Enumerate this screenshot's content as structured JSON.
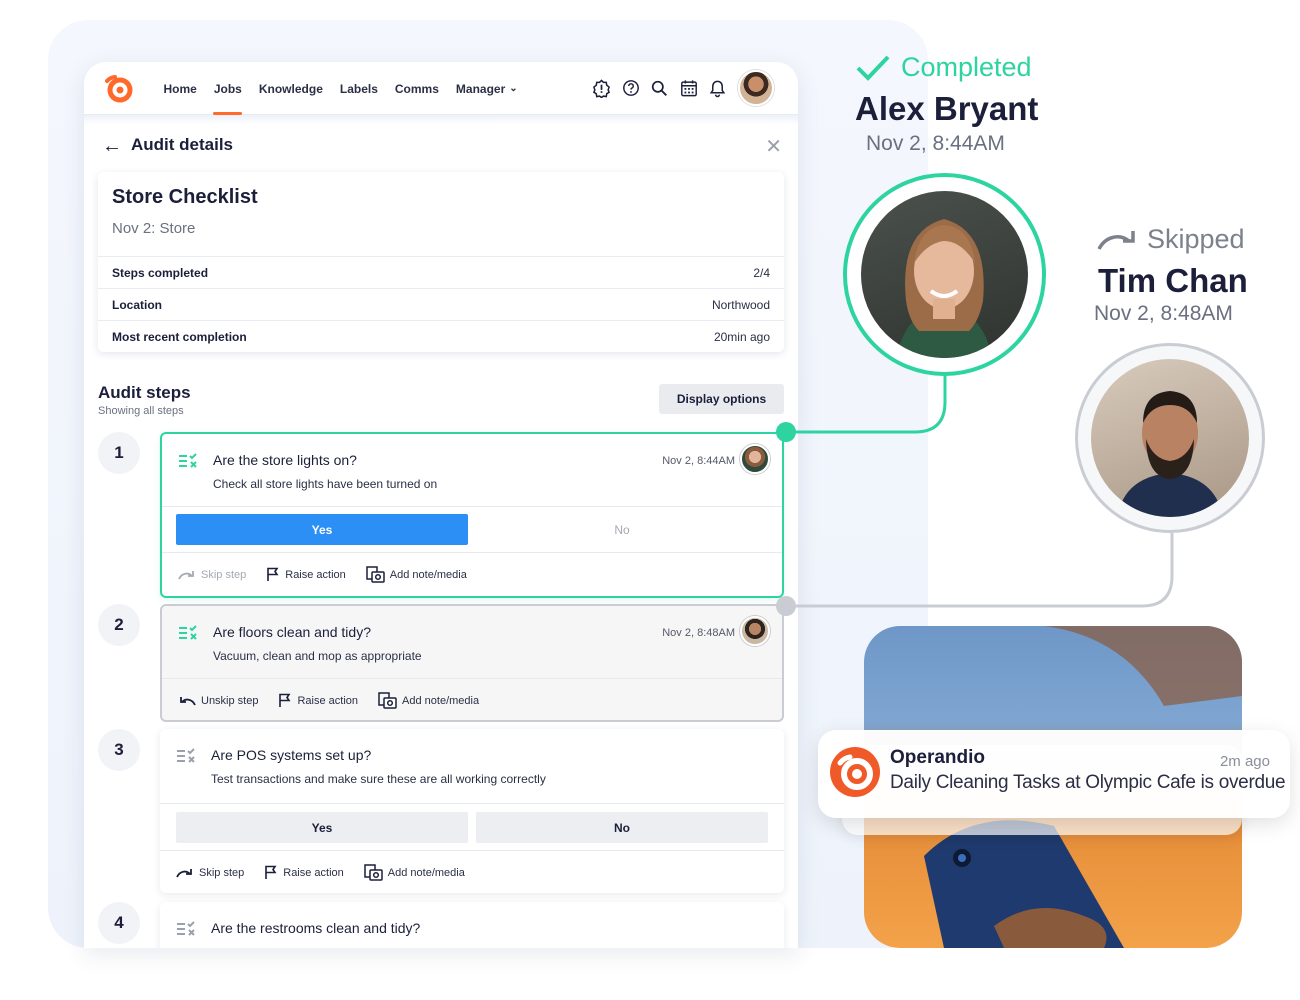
{
  "nav": {
    "items": [
      {
        "label": "Home",
        "active": false
      },
      {
        "label": "Jobs",
        "active": true
      },
      {
        "label": "Knowledge",
        "active": false
      },
      {
        "label": "Labels",
        "active": false
      },
      {
        "label": "Comms",
        "active": false
      },
      {
        "label": "Manager",
        "active": false
      }
    ],
    "icons": [
      "alert-icon",
      "help-icon",
      "search-icon",
      "calendar-icon",
      "bell-icon"
    ]
  },
  "header": {
    "title": "Audit details"
  },
  "summary": {
    "title": "Store Checklist",
    "subtitle": "Nov 2: Store",
    "rows": [
      {
        "key": "Steps completed",
        "value": "2/4"
      },
      {
        "key": "Location",
        "value": "Northwood"
      },
      {
        "key": "Most recent completion",
        "value": "20min ago"
      }
    ]
  },
  "audit_steps": {
    "title": "Audit steps",
    "subtitle": "Showing all steps",
    "display_options": "Display options",
    "steps": [
      {
        "number": "1",
        "question": "Are the store lights on?",
        "description": "Check all store lights have been turned on",
        "time": "Nov 2, 8:44AM",
        "yes": "Yes",
        "no": "No",
        "skip": "Skip step",
        "raise": "Raise action",
        "note": "Add note/media"
      },
      {
        "number": "2",
        "question": "Are floors clean and tidy?",
        "description": "Vacuum, clean and mop as appropriate",
        "time": "Nov 2, 8:48AM",
        "skip": "Unskip step",
        "raise": "Raise action",
        "note": "Add note/media"
      },
      {
        "number": "3",
        "question": "Are POS systems set up?",
        "description": "Test transactions and make sure these are all working correctly",
        "yes": "Yes",
        "no": "No",
        "skip": "Skip step",
        "raise": "Raise action",
        "note": "Add note/media"
      },
      {
        "number": "4",
        "question": "Are the restrooms clean and tidy?"
      }
    ]
  },
  "completed": {
    "status": "Completed",
    "name": "Alex Bryant",
    "time": "Nov 2, 8:44AM",
    "color": "#2dd4a0"
  },
  "skipped": {
    "status": "Skipped",
    "name": "Tim Chan",
    "time": "Nov 2, 8:48AM",
    "color": "#7d818c"
  },
  "notification": {
    "app": "Operandio",
    "time": "2m ago",
    "message": "Daily Cleaning Tasks at Olympic Cafe is overdue"
  },
  "colors": {
    "accent": "#ff6a2b",
    "primary_button": "#2b8ff6",
    "success": "#2dd4a0",
    "skipped": "#c9ccd3"
  }
}
